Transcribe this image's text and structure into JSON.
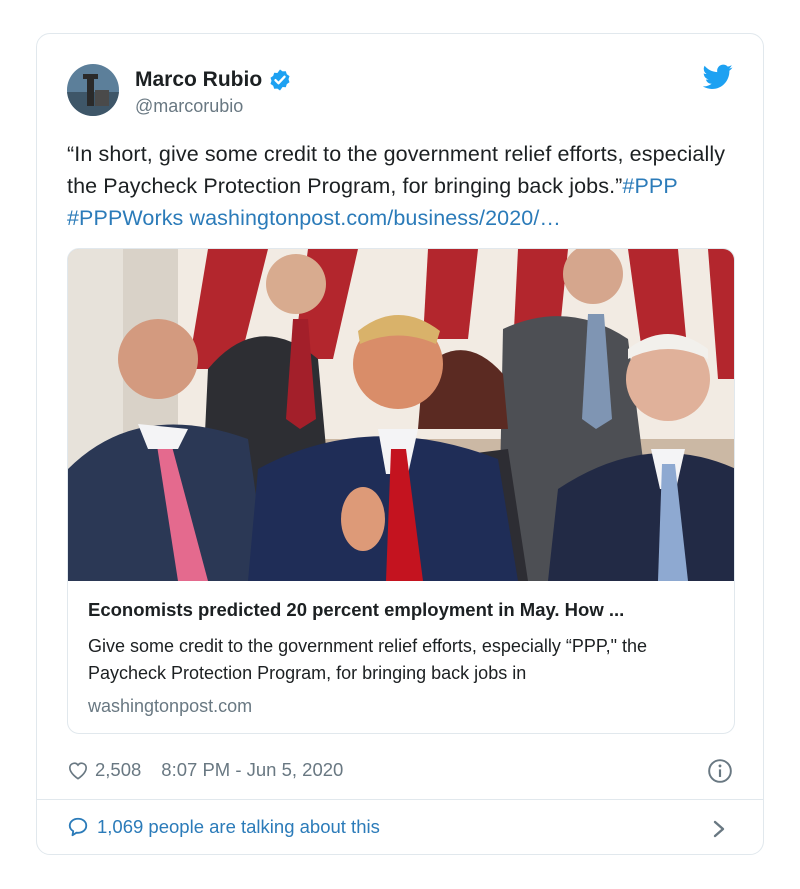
{
  "tweet": {
    "author": {
      "name": "Marco Rubio",
      "handle": "@marcorubio",
      "verified": true
    },
    "text_main": "“In short, give some credit to the government relief efforts, especially the Paycheck Protection Program, for bringing back jobs.”",
    "hashtag_1": "#PPP",
    "hashtag_2": "#PPPWorks",
    "url_text": "washingtonpost.com/business/2020/…",
    "link_card": {
      "title": "Economists predicted 20 percent employment in May. How ...",
      "description": "Give some credit to the government relief efforts, especially “PPP,\" the Paycheck Protection Program, for bringing back jobs in",
      "domain": "washingtonpost.com"
    },
    "likes": "2,508",
    "timestamp": "8:07 PM - Jun 5, 2020",
    "talking_text": "1,069 people are talking about this"
  },
  "icons": {
    "verified": "verified-badge-icon",
    "platform": "twitter-bird-icon",
    "like": "heart-icon",
    "info": "info-icon",
    "reply": "speech-bubble-icon",
    "chevron": "chevron-right-icon"
  },
  "colors": {
    "accent": "#1da1f2",
    "link": "#2b7bb9",
    "muted": "#697882",
    "text": "#1c2022",
    "border": "#e1e8ed"
  }
}
